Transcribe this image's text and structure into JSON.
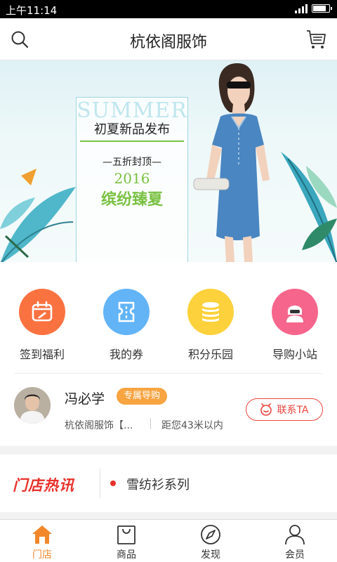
{
  "status_bar": {
    "time": "上午11:14"
  },
  "header": {
    "title": "杭依阁服饰"
  },
  "banner": {
    "summer": "SUMMER",
    "line1": "初夏新品发布",
    "line2": "—五折封顶—",
    "year": "2016",
    "slogan": "缤纷臻夏"
  },
  "quick_actions": [
    {
      "label": "签到福利",
      "icon": "calendar-edit-icon",
      "color": "#fb7241"
    },
    {
      "label": "我的券",
      "icon": "ticket-icon",
      "color": "#62b4f7"
    },
    {
      "label": "积分乐园",
      "icon": "coins-icon",
      "color": "#fdd13c"
    },
    {
      "label": "导购小站",
      "icon": "shopping-guide-icon",
      "color": "#f6668c"
    }
  ],
  "guide": {
    "name": "冯必学",
    "badge": "专属导购",
    "store": "杭依阁服饰【...",
    "distance": "距您43米以内",
    "contact_label": "联系TA"
  },
  "news": {
    "logo": "门店热讯",
    "headline": "雪纺衫系列"
  },
  "tabs": [
    {
      "label": "门店",
      "icon": "store-icon",
      "active": true
    },
    {
      "label": "商品",
      "icon": "bag-icon",
      "active": false
    },
    {
      "label": "发现",
      "icon": "compass-icon",
      "active": false
    },
    {
      "label": "会员",
      "icon": "user-icon",
      "active": false
    }
  ],
  "colors": {
    "accent": "#f2872a",
    "red": "#e8312a",
    "badge": "#f7a441"
  }
}
